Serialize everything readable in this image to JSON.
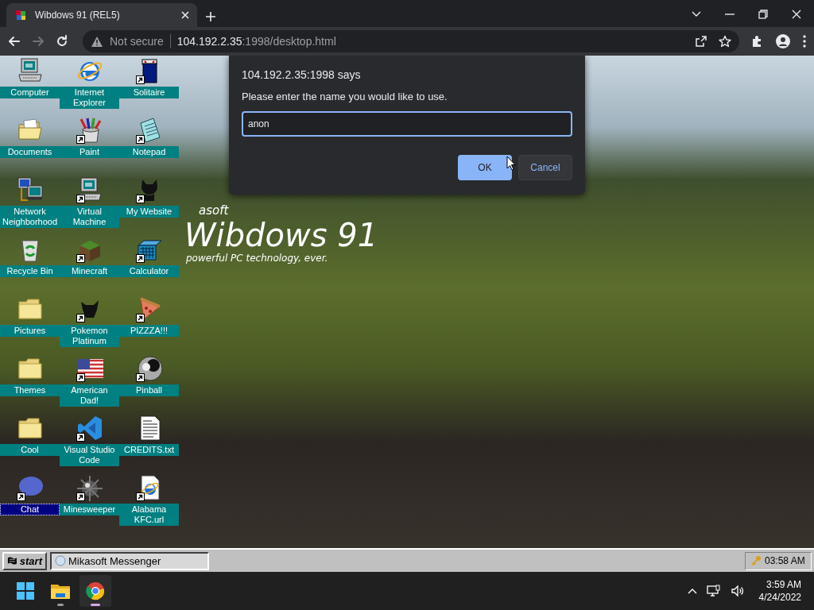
{
  "browser": {
    "tab": {
      "title": "Wibdows 91 (REL5)",
      "selected": true
    },
    "address": {
      "security": "Not secure",
      "host": "104.192.2.35",
      "path": ":1998/desktop.html"
    }
  },
  "desktop": {
    "icons": [
      {
        "label": "Computer",
        "kind": "computer",
        "shortcut": false,
        "selected": false
      },
      {
        "label": "Internet Explorer",
        "kind": "browser",
        "shortcut": false,
        "selected": false
      },
      {
        "label": "Solitaire",
        "kind": "cards",
        "shortcut": true,
        "selected": false
      },
      {
        "label": "Documents",
        "kind": "docfolder",
        "shortcut": false,
        "selected": false
      },
      {
        "label": "Paint",
        "kind": "paint",
        "shortcut": true,
        "selected": false
      },
      {
        "label": "Notepad",
        "kind": "notepad",
        "shortcut": true,
        "selected": false
      },
      {
        "label": "Network Neighborhood",
        "kind": "network",
        "shortcut": false,
        "selected": false
      },
      {
        "label": "Virtual Machine",
        "kind": "computer",
        "shortcut": true,
        "selected": false
      },
      {
        "label": "My Website",
        "kind": "octocat",
        "shortcut": true,
        "selected": false
      },
      {
        "label": "Recycle Bin",
        "kind": "recycle",
        "shortcut": false,
        "selected": false
      },
      {
        "label": "Minecraft",
        "kind": "block",
        "shortcut": true,
        "selected": false
      },
      {
        "label": "Calculator",
        "kind": "calculator",
        "shortcut": true,
        "selected": false
      },
      {
        "label": "Pictures",
        "kind": "folder",
        "shortcut": false,
        "selected": false
      },
      {
        "label": "Pokemon Platinum",
        "kind": "creature",
        "shortcut": true,
        "selected": false
      },
      {
        "label": "PIZZZA!!!",
        "kind": "pizza",
        "shortcut": true,
        "selected": false
      },
      {
        "label": "Themes",
        "kind": "folder",
        "shortcut": false,
        "selected": false
      },
      {
        "label": "American Dad!",
        "kind": "flag",
        "shortcut": true,
        "selected": false
      },
      {
        "label": "Pinball",
        "kind": "ball",
        "shortcut": true,
        "selected": false
      },
      {
        "label": "Cool",
        "kind": "folder",
        "shortcut": false,
        "selected": false
      },
      {
        "label": "Visual Studio Code",
        "kind": "vscode",
        "shortcut": true,
        "selected": false
      },
      {
        "label": "CREDITS.txt",
        "kind": "textfile",
        "shortcut": false,
        "selected": false
      },
      {
        "label": "Chat",
        "kind": "bubble",
        "shortcut": true,
        "selected": true
      },
      {
        "label": "Minesweeper",
        "kind": "mine",
        "shortcut": true,
        "selected": false
      },
      {
        "label": "Alabama KFC.url",
        "kind": "weblink",
        "shortcut": true,
        "selected": false
      }
    ],
    "logo": {
      "brand": "asoft",
      "name": "Wibdows 91",
      "tagline": "powerful PC technology, ever."
    }
  },
  "prompt": {
    "title": "104.192.2.35:1998 says",
    "message": "Please enter the name you would like to use.",
    "value": "anon",
    "buttons": [
      {
        "label": "OK",
        "kind": "primary"
      },
      {
        "label": "Cancel",
        "kind": "secondary"
      }
    ]
  },
  "wibdows_taskbar": {
    "start": "start",
    "tasks": [
      {
        "label": "Mikasoft Messenger"
      }
    ],
    "clock": "03:58 AM"
  },
  "os_taskbar": {
    "time": "3:59 AM",
    "date": "4/24/2022"
  }
}
